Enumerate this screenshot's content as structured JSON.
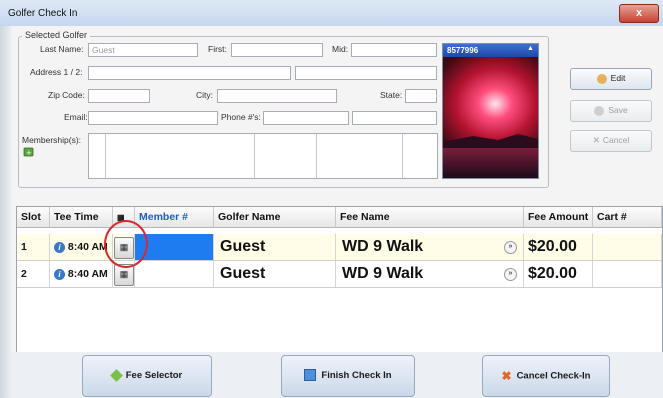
{
  "window": {
    "title": "Golfer Check In",
    "close_label": "x"
  },
  "selected_golfer": {
    "group_title": "Selected Golfer",
    "last_name_label": "Last Name:",
    "last_name_value": "Guest",
    "first_label": "First:",
    "mid_label": "Mid:",
    "address_label": "Address 1 / 2:",
    "zip_label": "Zip Code:",
    "city_label": "City:",
    "state_label": "State:",
    "email_label": "Email:",
    "phone_label": "Phone #'s:",
    "membership_label": "Membership(s):",
    "photo_id": "8577996",
    "photo_caret": "▲"
  },
  "actions": {
    "edit": "Edit",
    "save": "Save",
    "cancel": "Cancel"
  },
  "grid": {
    "columns": [
      "Slot",
      "Tee Time",
      "",
      "Member #",
      "Golfer Name",
      "Fee Name",
      "Fee Amount",
      "Cart #"
    ],
    "rows": [
      {
        "slot": "1",
        "tee_time": "8:40 AM",
        "member": "",
        "golfer": "Guest",
        "fee_name": "WD 9 Walk",
        "fee_amount": "$20.00",
        "cart": ""
      },
      {
        "slot": "2",
        "tee_time": "8:40 AM",
        "member": "",
        "golfer": "Guest",
        "fee_name": "WD 9 Walk",
        "fee_amount": "$20.00",
        "cart": ""
      }
    ]
  },
  "bottom": {
    "fee_selector": "Fee Selector",
    "finish": "Finish Check In",
    "cancel_checkin": "Cancel Check-In"
  },
  "colors": {
    "highlight": "#d6282f",
    "selected_row": "#fffde8",
    "member_cell": "#1e7cf0"
  }
}
